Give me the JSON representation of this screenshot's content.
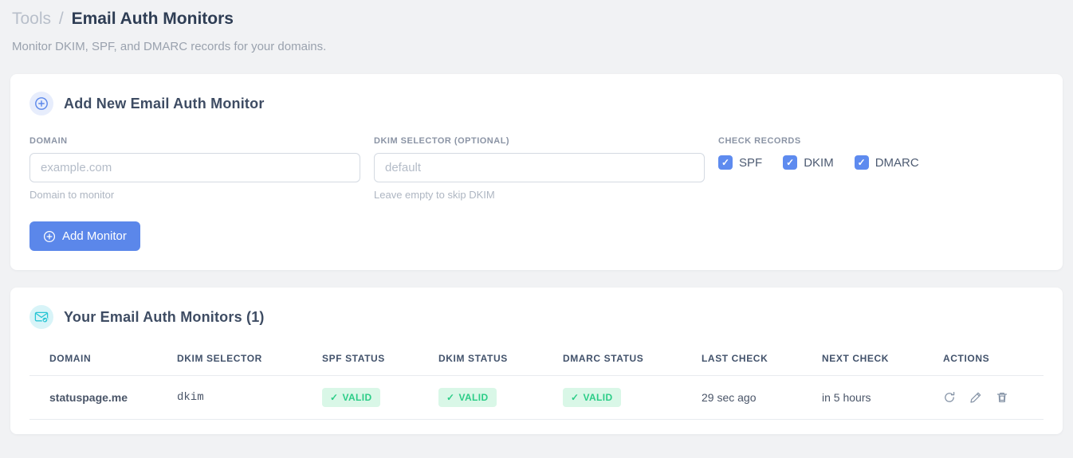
{
  "page": {
    "breadcrumb": {
      "parent": "Tools",
      "separator": "/",
      "current": "Email Auth Monitors"
    },
    "subtitle": "Monitor DKIM, SPF, and DMARC records for your domains."
  },
  "icons": {
    "check": "✓"
  },
  "add_monitor_card": {
    "title": "Add New Email Auth Monitor",
    "fields": {
      "domain": {
        "label": "DOMAIN",
        "value": "",
        "placeholder": "example.com",
        "helper": "Domain to monitor"
      },
      "dkim_selector": {
        "label": "DKIM SELECTOR (OPTIONAL)",
        "value": "",
        "placeholder": "default",
        "helper": "Leave empty to skip DKIM"
      }
    },
    "check_records": {
      "label": "CHECK RECORDS",
      "options": [
        {
          "label": "SPF",
          "checked": true
        },
        {
          "label": "DKIM",
          "checked": true
        },
        {
          "label": "DMARC",
          "checked": true
        }
      ]
    },
    "submit_label": "Add Monitor"
  },
  "monitors_card": {
    "title": "Your Email Auth Monitors (1)",
    "count": 1,
    "table": {
      "headers": [
        "DOMAIN",
        "DKIM SELECTOR",
        "SPF STATUS",
        "DKIM STATUS",
        "DMARC STATUS",
        "LAST CHECK",
        "NEXT CHECK",
        "ACTIONS"
      ],
      "rows": [
        {
          "domain": "statuspage.me",
          "dkim_selector": "dkim",
          "spf_status": "VALID",
          "dkim_status": "VALID",
          "dmarc_status": "VALID",
          "last_check": "29 sec ago",
          "next_check": "in 5 hours"
        }
      ]
    }
  },
  "colors": {
    "accent_blue": "#5b87ea",
    "checkbox_blue": "#5e8bef",
    "badge_green_bg": "#d9f7e7",
    "badge_green_text": "#2bcd87",
    "code_pink": "#ed4f92",
    "icon_teal": "#28c5d4",
    "page_bg": "#f1f2f4"
  }
}
